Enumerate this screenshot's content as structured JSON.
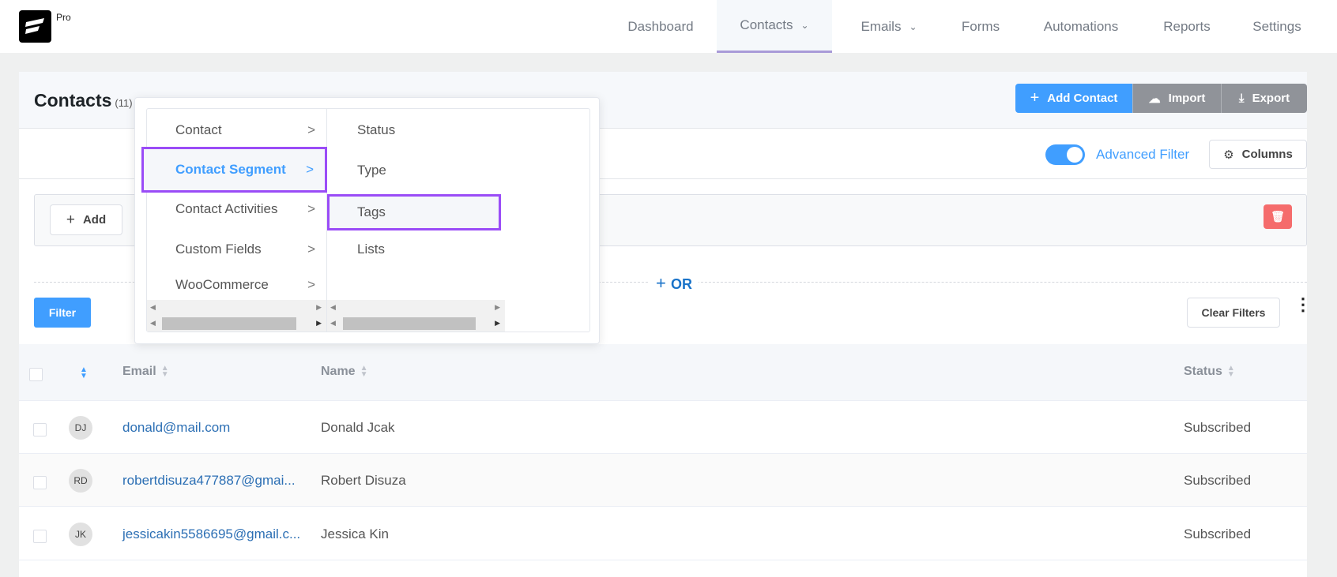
{
  "brand": {
    "badge": "Pro"
  },
  "nav": {
    "items": [
      {
        "label": "Dashboard"
      },
      {
        "label": "Contacts",
        "dropdown": true,
        "active": true
      },
      {
        "label": "Emails",
        "dropdown": true
      },
      {
        "label": "Forms"
      },
      {
        "label": "Automations"
      },
      {
        "label": "Reports"
      },
      {
        "label": "Settings"
      }
    ]
  },
  "header": {
    "title": "Contacts",
    "count": "(11)",
    "add_contact": "Add Contact",
    "import": "Import",
    "export": "Export"
  },
  "toolbar": {
    "advanced_filter": "Advanced Filter",
    "advanced_filter_on": true,
    "columns": "Columns"
  },
  "filter": {
    "add": "Add",
    "or": "OR",
    "filter_btn": "Filter",
    "clear": "Clear Filters"
  },
  "menu": {
    "left": [
      {
        "label": "Contact"
      },
      {
        "label": "Contact Segment",
        "active": true
      },
      {
        "label": "Contact Activities"
      },
      {
        "label": "Custom Fields"
      },
      {
        "label": "WooCommerce"
      }
    ],
    "right": [
      {
        "label": "Status"
      },
      {
        "label": "Type"
      },
      {
        "label": "Tags",
        "highlighted": true
      },
      {
        "label": "Lists"
      }
    ]
  },
  "table": {
    "headers": {
      "email": "Email",
      "name": "Name",
      "status": "Status"
    },
    "rows": [
      {
        "initials": "DJ",
        "email": "donald@mail.com",
        "name": "Donald Jcak",
        "status": "Subscribed"
      },
      {
        "initials": "RD",
        "email": "robertdisuza477887@gmai...",
        "name": "Robert Disuza",
        "status": "Subscribed"
      },
      {
        "initials": "JK",
        "email": "jessicakin5586695@gmail.c...",
        "name": "Jessica Kin",
        "status": "Subscribed"
      }
    ]
  },
  "colors": {
    "primary": "#409eff",
    "highlight": "#9a4cf7",
    "danger": "#f56c6c",
    "gray_btn": "#909399"
  }
}
